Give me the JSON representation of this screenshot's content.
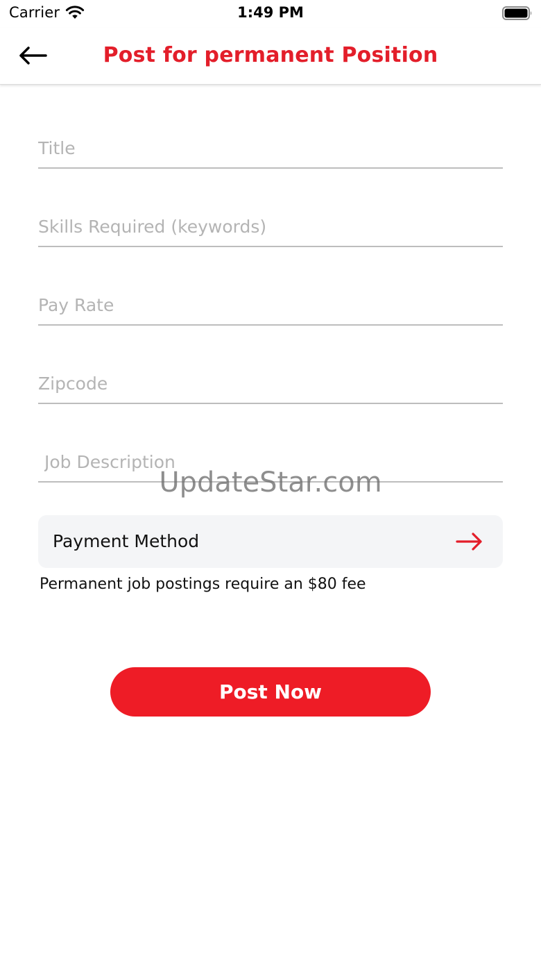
{
  "status_bar": {
    "carrier": "Carrier",
    "time": "1:49 PM"
  },
  "header": {
    "title": "Post for permanent Position"
  },
  "form": {
    "title_placeholder": "Title",
    "skills_placeholder": "Skills Required (keywords)",
    "pay_rate_placeholder": "Pay Rate",
    "zipcode_placeholder": "Zipcode",
    "job_description_placeholder": "Job Description"
  },
  "watermark": "UpdateStar.com",
  "payment": {
    "label": "Payment Method"
  },
  "fee_note": "Permanent job postings require an $80 fee",
  "actions": {
    "post_label": "Post Now"
  },
  "colors": {
    "accent": "#e31e2a",
    "button": "#ee1c26",
    "field_bg": "#f4f5f7",
    "underline": "#bdbdbd"
  },
  "icons": {
    "back": "arrow-left-icon",
    "payment": "arrow-right-icon",
    "wifi": "wifi-icon",
    "battery": "battery-icon"
  }
}
